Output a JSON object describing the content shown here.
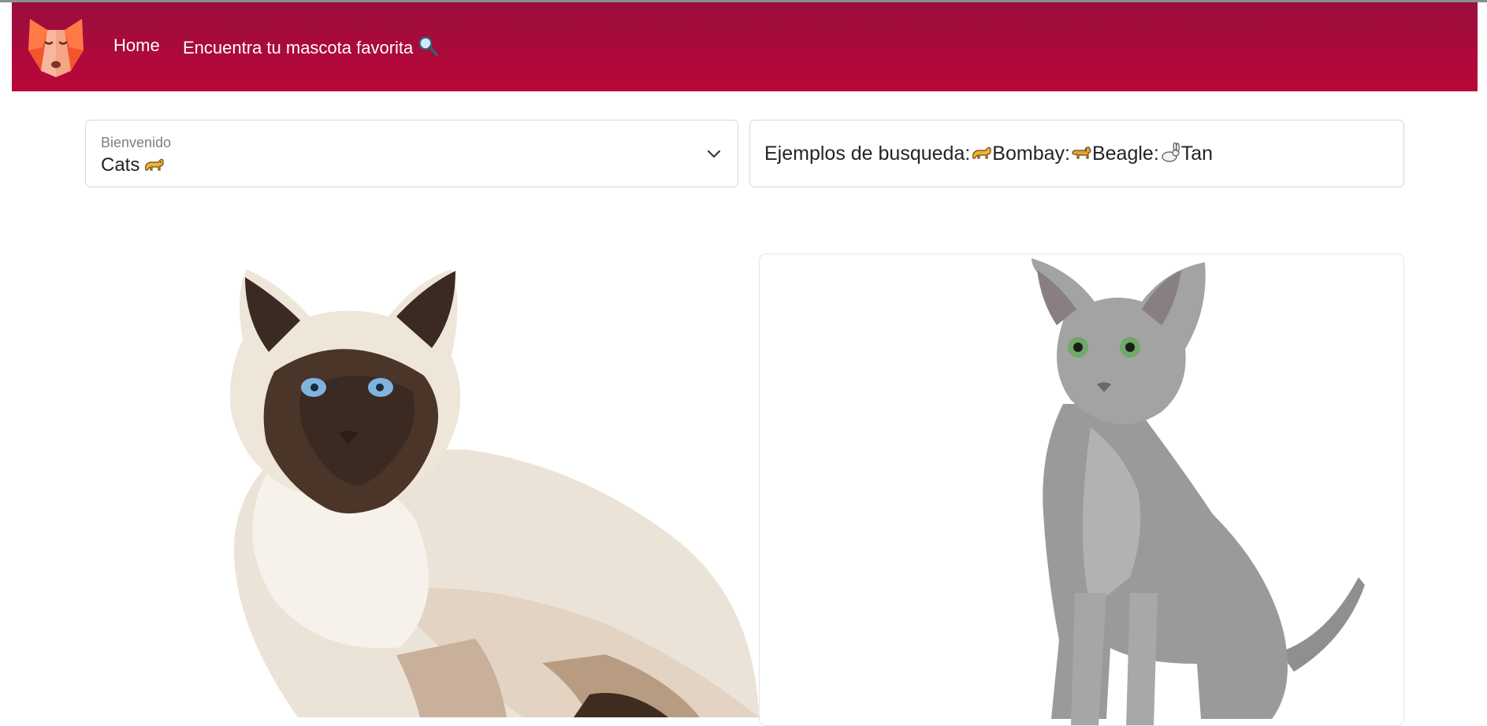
{
  "nav": {
    "logo_icon": "fox-logo-icon",
    "home_label": "Home",
    "find_label": "Encuentra tu mascota favorita",
    "find_icon": "magnifier-icon",
    "bar_color_top": "#9a0e3c",
    "bar_color_bottom": "#ba0639"
  },
  "select": {
    "label": "Bienvenido",
    "value": "Cats",
    "value_icon": "cat-emoji-icon"
  },
  "examples": {
    "prefix": "Ejemplos de busqueda:",
    "items": [
      {
        "icon": "cat-emoji-icon",
        "text": "Bombay:"
      },
      {
        "icon": "dog-emoji-icon",
        "text": "Beagle:"
      },
      {
        "icon": "rabbit-emoji-icon",
        "text": "Tan"
      }
    ]
  },
  "cards": [
    {
      "subject": "birman-cat-photo"
    },
    {
      "subject": "russian-blue-cat-photo"
    }
  ]
}
